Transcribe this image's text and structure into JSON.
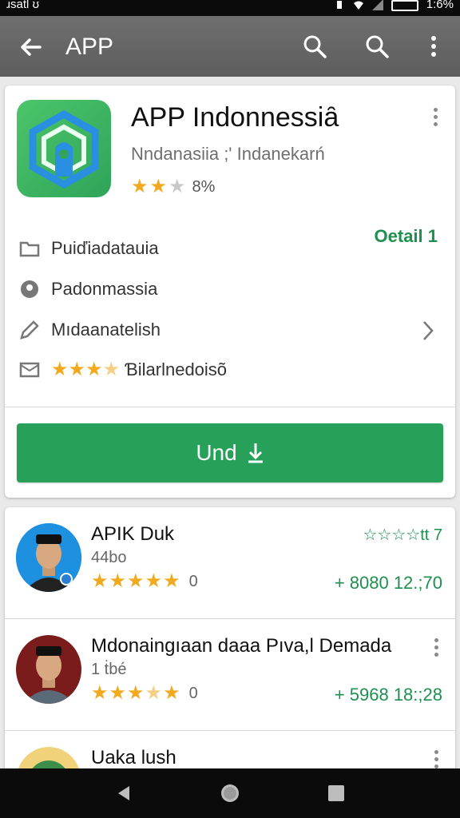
{
  "status_bar": {
    "carrier": "ɹsatl ʊ",
    "time": "1:6%"
  },
  "app_bar": {
    "title": "APP",
    "icons": [
      "back-arrow-icon",
      "search-icon",
      "search-icon",
      "more-vert-icon"
    ]
  },
  "app": {
    "name": "APP Indonnessiȃ",
    "developer": "Nndanasiia ;' Indanekarń",
    "rating_stars": 2,
    "rating_text": "8%",
    "detail_link": "Oetail 1",
    "rows": [
      {
        "icon": "folder-icon",
        "text": "Puiďiadatauia"
      },
      {
        "icon": "location-pin-icon",
        "text": "Padonmassia"
      },
      {
        "icon": "pencil-icon",
        "text": "Mıdaanatelish"
      },
      {
        "icon": "mail-icon",
        "stars": 3.5,
        "text": "Ɓilarlnedoisõ"
      }
    ],
    "install_button": "Und"
  },
  "list": [
    {
      "name": "APIK Duk",
      "sub": "44bo",
      "stars": 5,
      "count": "0",
      "badge": "☆☆☆☆tt 7",
      "price": "+ 8080 12.;70",
      "avatar_bg": "#1e90e0"
    },
    {
      "name": "Mdonaingıaan daaa Pıva,l Demada",
      "sub": "1 ṫbé",
      "stars": 4.5,
      "count": "0",
      "price": "+ 5968 18:;28",
      "avatar_bg": "#7a1c1c"
    },
    {
      "name": "Uaka lush",
      "avatar_bg": "#f0d27a"
    }
  ],
  "colors": {
    "accent_green": "#27a15a",
    "link_green": "#1d8f4e",
    "star": "#f2a91e",
    "app_bar": "#666666"
  }
}
